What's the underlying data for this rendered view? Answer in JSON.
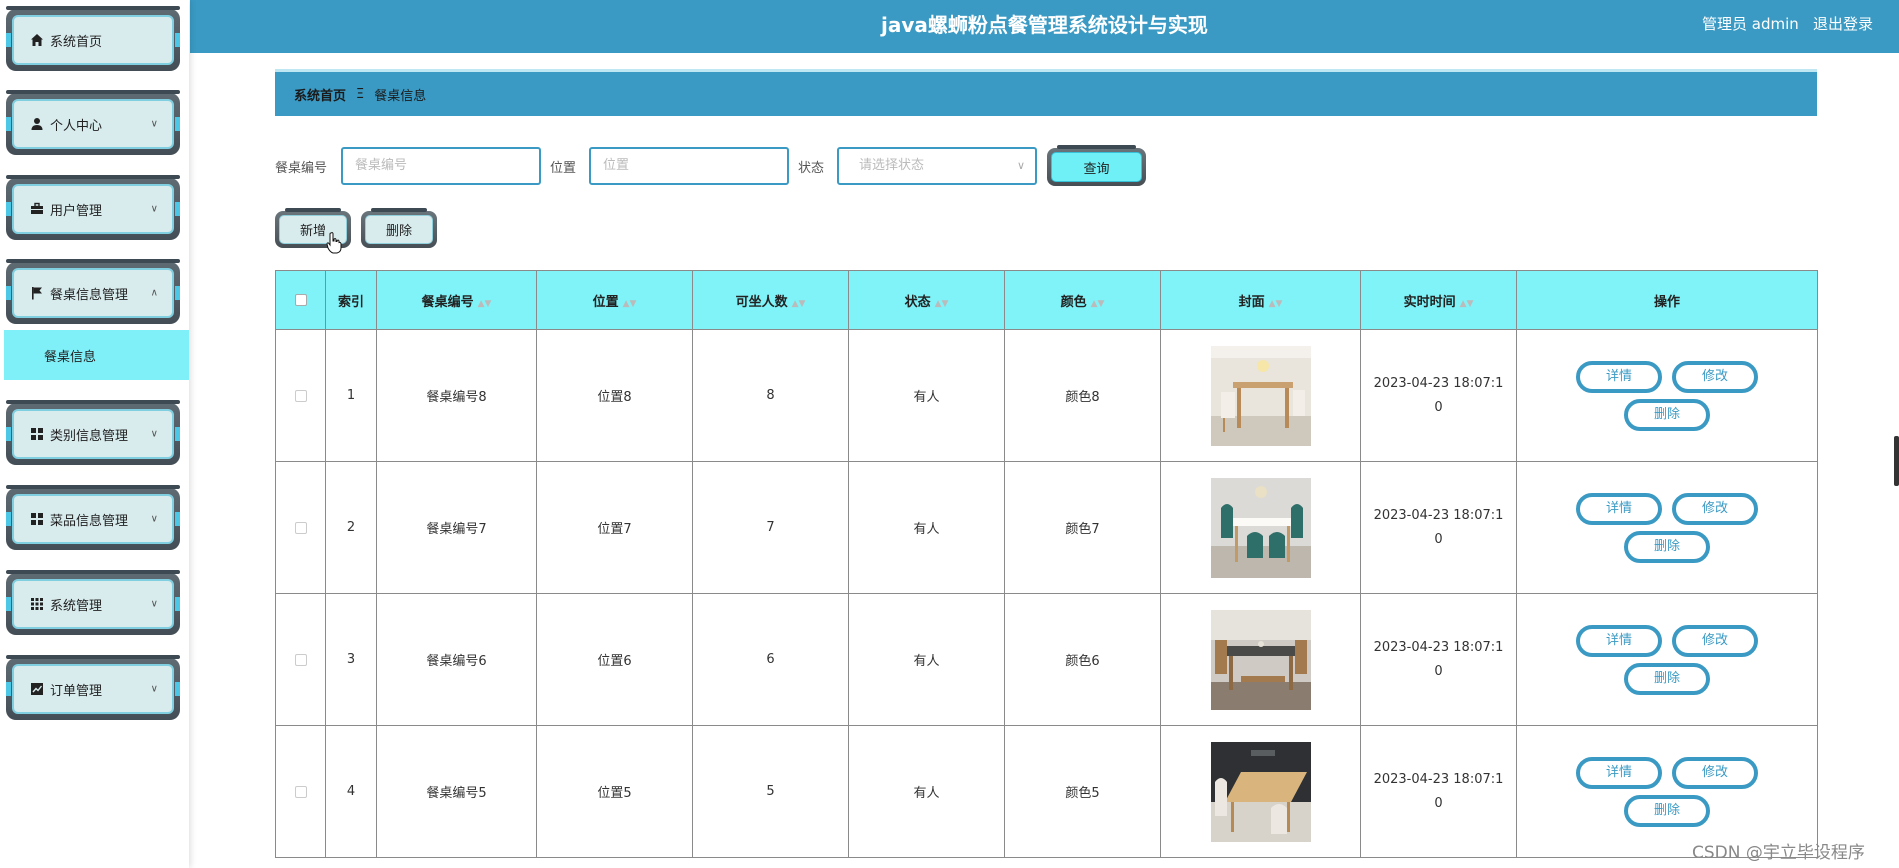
{
  "header": {
    "title": "java螺蛳粉点餐管理系统设计与实现",
    "user_label": "管理员 admin",
    "logout_label": "退出登录"
  },
  "sidebar": {
    "items": [
      {
        "label": "系统首页",
        "icon": "home-icon"
      },
      {
        "label": "个人中心",
        "icon": "user-icon"
      },
      {
        "label": "用户管理",
        "icon": "briefcase-icon"
      },
      {
        "label": "餐桌信息管理",
        "icon": "flag-icon",
        "expanded": true
      },
      {
        "label": "类别信息管理",
        "icon": "grid-icon"
      },
      {
        "label": "菜品信息管理",
        "icon": "grid-icon"
      },
      {
        "label": "系统管理",
        "icon": "apps-icon"
      },
      {
        "label": "订单管理",
        "icon": "chart-icon"
      }
    ],
    "submenu": {
      "label": "餐桌信息"
    }
  },
  "breadcrumb": {
    "home": "系统首页",
    "separator": "Ξ",
    "current": "餐桌信息"
  },
  "search": {
    "table_no_label": "餐桌编号",
    "table_no_placeholder": "餐桌编号",
    "location_label": "位置",
    "location_placeholder": "位置",
    "status_label": "状态",
    "status_placeholder": "请选择状态",
    "query_label": "查询"
  },
  "actions": {
    "add_label": "新增",
    "delete_label": "删除"
  },
  "table": {
    "columns": [
      "索引",
      "餐桌编号",
      "位置",
      "可坐人数",
      "状态",
      "颜色",
      "封面",
      "实时时间",
      "操作"
    ],
    "rows": [
      {
        "index": "1",
        "table_no": "餐桌编号8",
        "location": "位置8",
        "seats": "8",
        "status": "有人",
        "color": "颜色8",
        "time_line1": "2023-04-23 18:07:1",
        "time_line2": "0"
      },
      {
        "index": "2",
        "table_no": "餐桌编号7",
        "location": "位置7",
        "seats": "7",
        "status": "有人",
        "color": "颜色7",
        "time_line1": "2023-04-23 18:07:1",
        "time_line2": "0"
      },
      {
        "index": "3",
        "table_no": "餐桌编号6",
        "location": "位置6",
        "seats": "6",
        "status": "有人",
        "color": "颜色6",
        "time_line1": "2023-04-23 18:07:1",
        "time_line2": "0"
      },
      {
        "index": "4",
        "table_no": "餐桌编号5",
        "location": "位置5",
        "seats": "5",
        "status": "有人",
        "color": "颜色5",
        "time_line1": "2023-04-23 18:07:1",
        "time_line2": "0"
      }
    ],
    "row_actions": {
      "detail": "详情",
      "edit": "修改",
      "delete": "删除"
    }
  },
  "watermark": "CSDN @宇立毕设程序",
  "colors": {
    "primary": "#3a9ac4",
    "header_cell": "#7ff3f8",
    "submenu": "#7ff0f8",
    "menu_inner": "#d8ebed"
  }
}
